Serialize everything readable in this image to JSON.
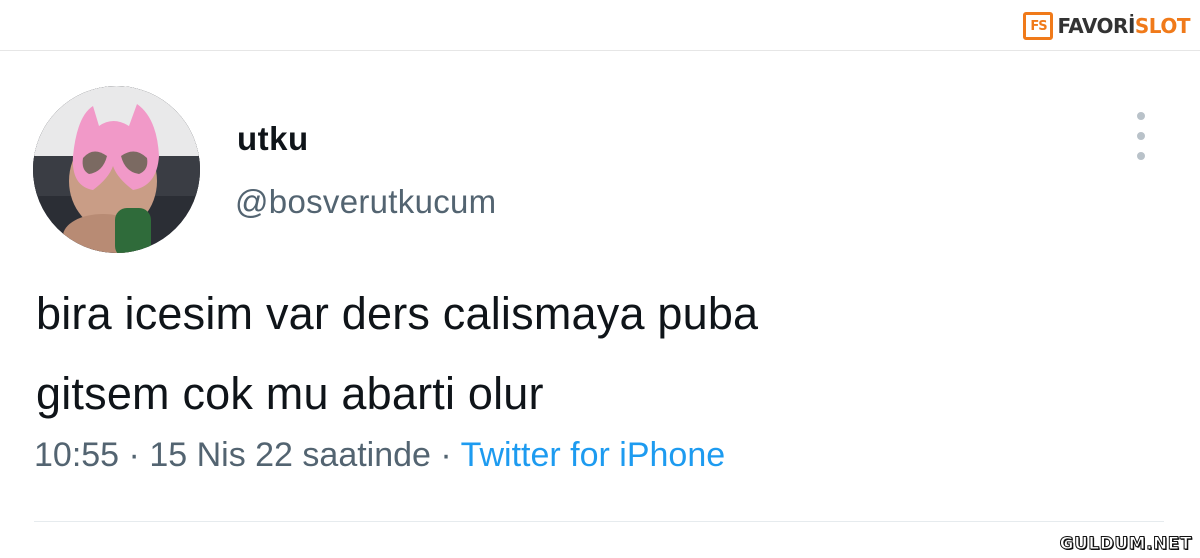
{
  "brand": {
    "mark": "FS",
    "name_part1": "FAVORİ",
    "name_part2": "SLOT",
    "accent_color": "#f07a1a"
  },
  "tweet": {
    "display_name": "utku",
    "handle": "@bosverutkucum",
    "more_icon": "more-vertical-icon",
    "text_line1": "bira icesim var ders calismaya puba",
    "text_line2": "gitsem cok mu abarti olur",
    "time": "10:55",
    "date": "15 Nis 22 saatinde",
    "separator": "·",
    "source": "Twitter for iPhone",
    "link_color": "#1d9bf0"
  },
  "watermark": "GULDUM.NET"
}
